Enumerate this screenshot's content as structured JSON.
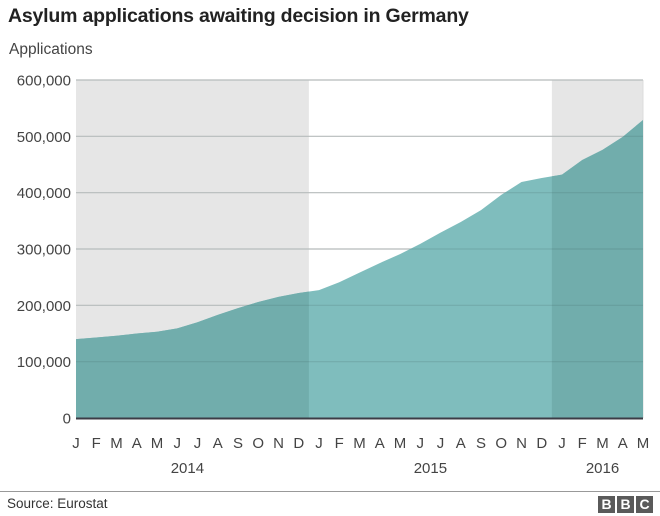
{
  "header": {
    "title": "Asylum applications awaiting decision in Germany",
    "subtitle": "Applications"
  },
  "footer": {
    "source": "Source: Eurostat",
    "logo_letters": [
      "B",
      "B",
      "C"
    ]
  },
  "colors": {
    "fill_light": "#7fbdbd",
    "fill_dark": "#71adac",
    "shade": "#e6e6e6",
    "grid": "#d2d2d2",
    "baseline": "#3c3c46"
  },
  "chart_data": {
    "type": "area",
    "title": "Asylum applications awaiting decision in Germany",
    "ylabel": "Applications",
    "xlabel": "",
    "ylim": [
      0,
      600000
    ],
    "yticks": [
      0,
      100000,
      200000,
      300000,
      400000,
      500000,
      600000
    ],
    "ytick_labels": [
      "0",
      "100,000",
      "200,000",
      "300,000",
      "400,000",
      "500,000",
      "600,000"
    ],
    "grid": true,
    "legend": "none",
    "x": [
      "Jan 2014",
      "Feb 2014",
      "Mar 2014",
      "Apr 2014",
      "May 2014",
      "Jun 2014",
      "Jul 2014",
      "Aug 2014",
      "Sep 2014",
      "Oct 2014",
      "Nov 2014",
      "Dec 2014",
      "Jan 2015",
      "Feb 2015",
      "Mar 2015",
      "Apr 2015",
      "May 2015",
      "Jun 2015",
      "Jul 2015",
      "Aug 2015",
      "Sep 2015",
      "Oct 2015",
      "Nov 2015",
      "Dec 2015",
      "Jan 2016",
      "Feb 2016",
      "Mar 2016",
      "Apr 2016",
      "May 2016"
    ],
    "month_labels": [
      "J",
      "F",
      "M",
      "A",
      "M",
      "J",
      "J",
      "A",
      "S",
      "O",
      "N",
      "D",
      "J",
      "F",
      "M",
      "A",
      "M",
      "J",
      "J",
      "A",
      "S",
      "O",
      "N",
      "D",
      "J",
      "F",
      "M",
      "A",
      "M"
    ],
    "year_labels": [
      {
        "label": "2014",
        "center_month_index": 5.5
      },
      {
        "label": "2015",
        "center_month_index": 17.5
      },
      {
        "label": "2016",
        "center_month_index": 26
      }
    ],
    "shaded_years": [
      {
        "label": "2014",
        "from_index": 0,
        "to_index": 11
      },
      {
        "label": "2016",
        "from_index": 24,
        "to_index": 28
      }
    ],
    "series": [
      {
        "name": "Applications awaiting decision",
        "values": [
          140000,
          143000,
          146000,
          150000,
          153000,
          159000,
          170000,
          183000,
          195000,
          206000,
          215000,
          222000,
          227000,
          241000,
          258000,
          275000,
          291000,
          309000,
          329000,
          348000,
          369000,
          396000,
          419000,
          426000,
          432000,
          458000,
          476000,
          499000,
          529000
        ]
      }
    ]
  }
}
